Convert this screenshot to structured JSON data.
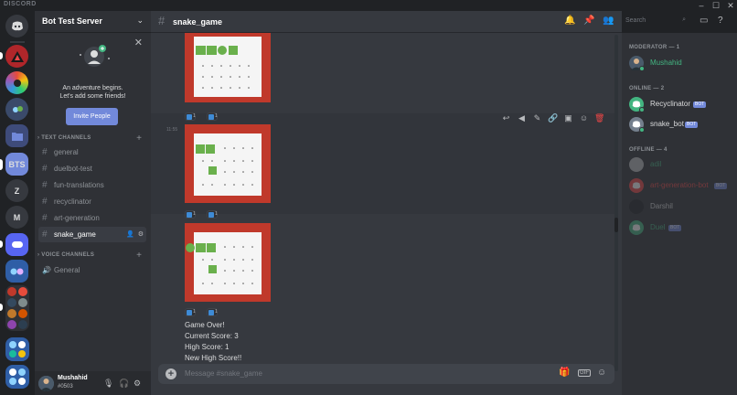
{
  "window": {
    "brand": "DISCORD",
    "controls": [
      "minimize-icon",
      "maximize-icon",
      "close-icon"
    ]
  },
  "servers": [
    {
      "label": "",
      "icon": "discord-logo-icon",
      "color": "#36393f"
    },
    {
      "label": "",
      "icon": "red-triangle-server",
      "color": "#b0262a"
    },
    {
      "label": "",
      "icon": "rainbow-server",
      "color": "#6b4bd0"
    },
    {
      "label": "",
      "icon": "robot-server",
      "color": "#3a4a6a"
    },
    {
      "label": "",
      "icon": "folder-icon",
      "color": "#3e4b7a"
    },
    {
      "label": "BTS",
      "icon": "",
      "color": "#7289da"
    },
    {
      "label": "Z",
      "icon": "",
      "color": "#36393f"
    },
    {
      "label": "M",
      "icon": "",
      "color": "#36393f"
    },
    {
      "label": "",
      "icon": "mystery-server",
      "color": "#5765f2"
    },
    {
      "label": "",
      "icon": "game-server",
      "color": "#2f5ea6"
    },
    {
      "label": "",
      "icon": "avatar-folder",
      "color": "#36393f"
    },
    {
      "label": "",
      "icon": "anime-folder",
      "color": "#36393f"
    },
    {
      "label": "",
      "icon": "apps-folder",
      "color": "#2f5ea6"
    },
    {
      "label": "",
      "icon": "more-folder",
      "color": "#2f5ea6"
    }
  ],
  "guild": {
    "name": "Bot Test Server",
    "welcome_line1": "An adventure begins.",
    "welcome_line2": "Let's add some friends!",
    "invite_label": "Invite People",
    "text_category": "TEXT CHANNELS",
    "voice_category": "VOICE CHANNELS",
    "text_channels": [
      "general",
      "duelbot-test",
      "fun-translations",
      "recyclinator",
      "art-generation",
      "snake_game"
    ],
    "voice_channels": [
      "General"
    ]
  },
  "user": {
    "name": "Mushahid",
    "discriminator": "#0503"
  },
  "chat": {
    "channel": "snake_game",
    "search_placeholder": "Search",
    "composer_placeholder": "Message #snake_game",
    "gif_label": "GIF",
    "timestamp": "11:55",
    "reaction_counts": [
      "1",
      "1"
    ],
    "game_over_lines": [
      "Game Over!",
      "Current Score: 3",
      "High Score: 1",
      "New High Score!!"
    ]
  },
  "members": {
    "groups": [
      {
        "label": "MODERATOR — 1",
        "items": [
          {
            "name": "Mushahid",
            "bot": false,
            "color": "#43b581",
            "status": "#43b581"
          }
        ]
      },
      {
        "label": "ONLINE — 2",
        "items": [
          {
            "name": "Recyclinator",
            "bot": true,
            "color": "#dcddde",
            "status": "#43b581"
          },
          {
            "name": "snake_bot",
            "bot": true,
            "color": "#dcddde",
            "status": "#43b581"
          }
        ]
      },
      {
        "label": "OFFLINE — 4",
        "items": [
          {
            "name": "adil",
            "bot": false,
            "color": "#43b581",
            "status": ""
          },
          {
            "name": "art-generation-bot",
            "bot": true,
            "color": "#f04747",
            "status": ""
          },
          {
            "name": "Darshil",
            "bot": false,
            "color": "#dcddde",
            "status": ""
          },
          {
            "name": "Duel",
            "bot": true,
            "color": "#43b581",
            "status": ""
          }
        ]
      }
    ],
    "bot_tag": "BOT"
  },
  "colors": {
    "accent": "#7289da",
    "online": "#43b581",
    "danger": "#f04747",
    "brick": "#c0392b",
    "snake": "#6ab04c"
  }
}
